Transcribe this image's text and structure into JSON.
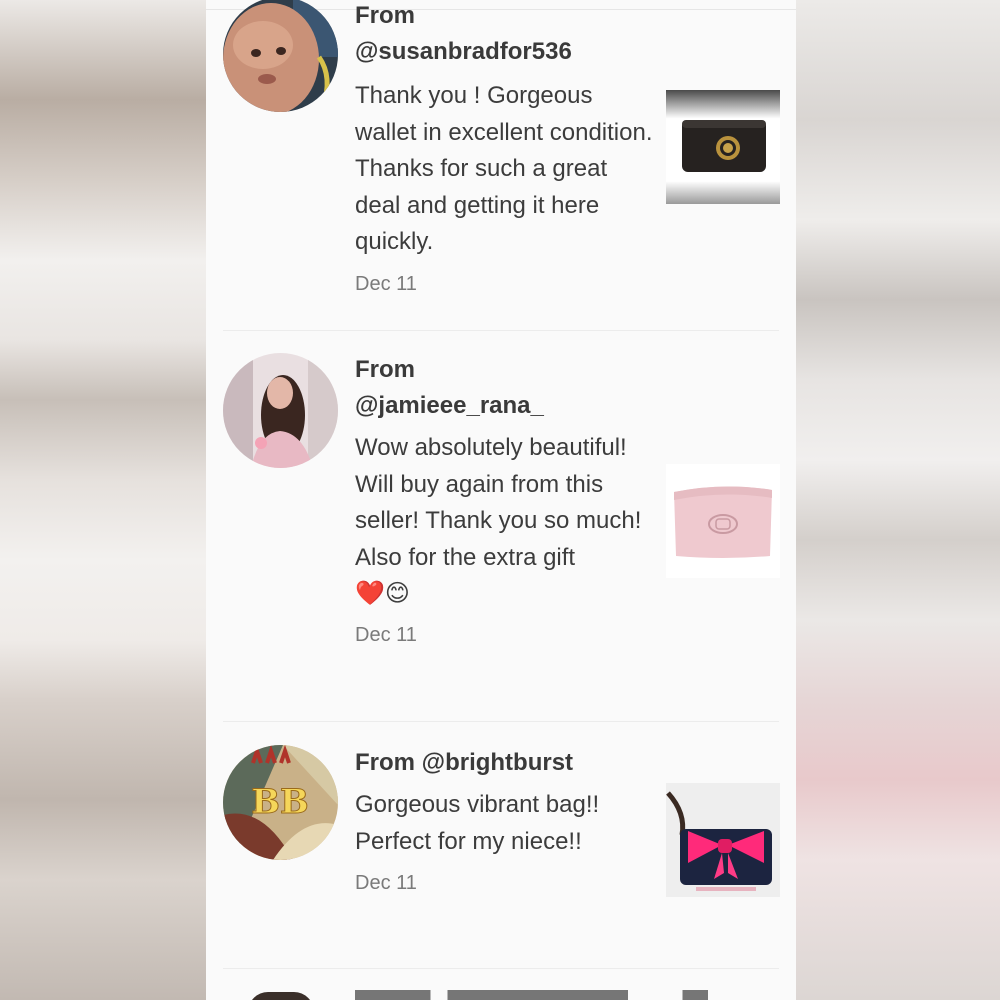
{
  "reviews": [
    {
      "from_line_1": "From",
      "from_line_2": "@susanbradfor536",
      "comment": "Thank you ! Gorgeous wallet in excellent condition. Thanks for such a great deal and getting it here quickly.",
      "date": "Dec 11",
      "avatar": "baby-photo-avatar",
      "thumbnail": "black-wallet-thumbnail"
    },
    {
      "from_line_1": "From",
      "from_line_2": "@jamieee_rana_",
      "comment": "Wow absolutely beautiful! Will buy again from this seller! Thank you so much! Also for the extra gift",
      "emoji": "❤️😊",
      "date": "Dec 11",
      "avatar": "woman-photo-avatar",
      "thumbnail": "pink-pouch-thumbnail"
    },
    {
      "from_line_1": "From @brightburst",
      "comment": "Gorgeous vibrant bag!! Perfect for my niece!!",
      "date": "Dec 11",
      "avatar": "bb-logo-avatar",
      "avatar_text": "BB",
      "thumbnail": "pink-bow-bag-thumbnail"
    }
  ],
  "colors": {
    "panel_bg": "#fafafa",
    "text": "#3c3c3c",
    "date": "#7a7a7a",
    "divider": "#ececec"
  }
}
